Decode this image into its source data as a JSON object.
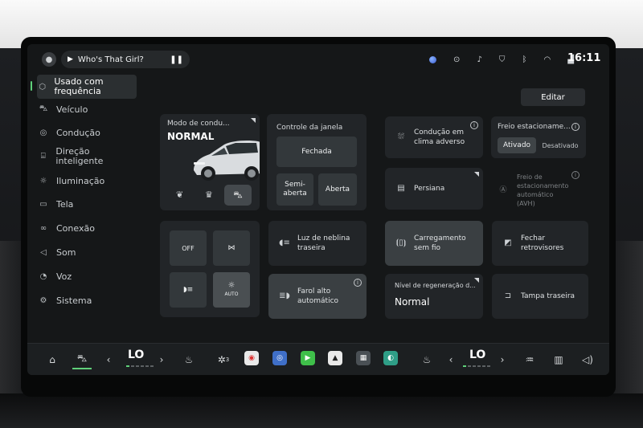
{
  "status_bar": {
    "media_title": "Who's That Girl?",
    "time": "16:11"
  },
  "sidebar": {
    "items": [
      {
        "label": "Usado com frequência",
        "icon": "cube-icon",
        "active": true
      },
      {
        "label": "Veículo",
        "icon": "car-icon"
      },
      {
        "label": "Condução",
        "icon": "steering-wheel-icon"
      },
      {
        "label": "Direção inteligente",
        "icon": "smart-driving-icon"
      },
      {
        "label": "Iluminação",
        "icon": "light-icon"
      },
      {
        "label": "Tela",
        "icon": "screen-icon"
      },
      {
        "label": "Conexão",
        "icon": "link-icon"
      },
      {
        "label": "Som",
        "icon": "speaker-icon"
      },
      {
        "label": "Voz",
        "icon": "voice-icon"
      },
      {
        "label": "Sistema",
        "icon": "gear-icon"
      }
    ]
  },
  "toolbar": {
    "edit_label": "Editar"
  },
  "drive_mode": {
    "title": "Modo de condu...",
    "value": "NORMAL",
    "modes": [
      "eco-leaf-icon",
      "crown-icon",
      "car-icon"
    ]
  },
  "window_control": {
    "title": "Controle da janela",
    "closed": "Fechada",
    "half_open": "Semi-aberta",
    "open": "Aberta"
  },
  "adverse_weather": {
    "label": "Condução em clima adverso"
  },
  "parking_brake": {
    "title": "Freio estacioname...",
    "on": "Ativado",
    "off": "Desativado"
  },
  "sunshade": {
    "label": "Persiana"
  },
  "avh": {
    "label": "Freio de estacionamento automático (AVH)"
  },
  "lights": {
    "off_label": "OFF",
    "auto_label": "AUTO"
  },
  "rear_fog": {
    "label": "Luz de neblina traseira"
  },
  "wireless_charging": {
    "label": "Carregamento sem fio"
  },
  "fold_mirrors": {
    "label": "Fechar retrovisores"
  },
  "high_beam": {
    "label": "Farol alto automático"
  },
  "regen": {
    "title": "Nível de regeneração d...",
    "value": "Normal"
  },
  "tailgate": {
    "label": "Tampa traseira"
  },
  "dock": {
    "left_temp": "LO",
    "right_temp": "LO",
    "fan_level": "3"
  },
  "colors": {
    "accent": "#5fd07a",
    "card": "#222528",
    "background": "#151718"
  }
}
